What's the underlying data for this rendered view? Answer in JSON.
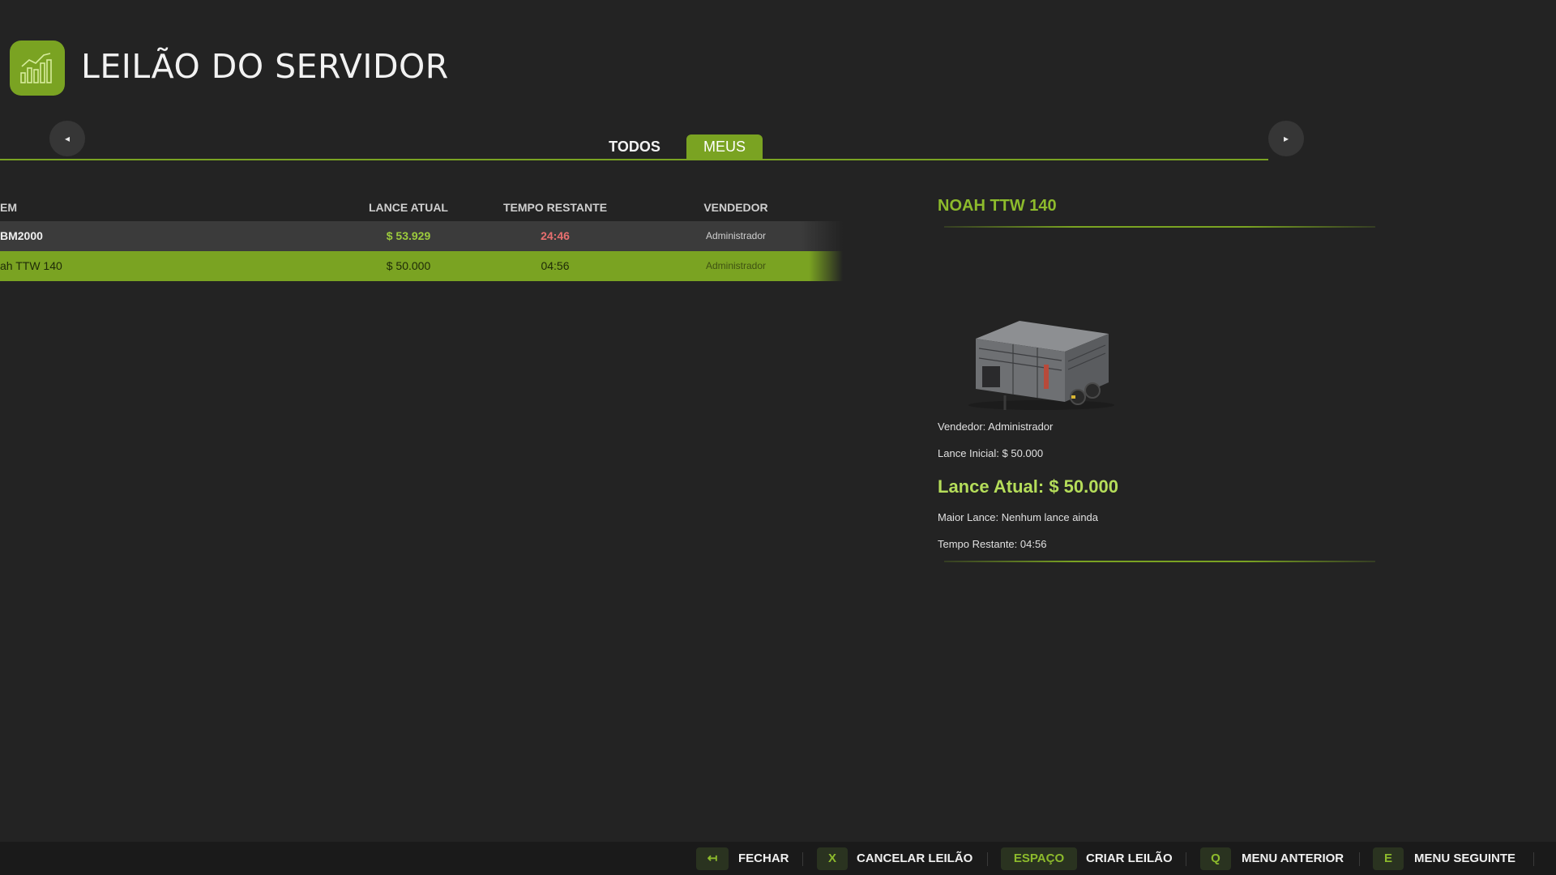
{
  "header": {
    "title": "LEILÃO DO SERVIDOR",
    "icon": "chart-bars-icon"
  },
  "tabs": [
    {
      "label": "TODOS",
      "active": false
    },
    {
      "label": "MEUS",
      "active": true
    }
  ],
  "nav": {
    "prev_icon": "◂",
    "next_icon": "▸"
  },
  "table": {
    "headers": {
      "item": "EM",
      "price": "LANCE ATUAL",
      "time": "TEMPO RESTANTE",
      "seller": "VENDEDOR"
    },
    "rows": [
      {
        "item": "BM2000",
        "price": "$ 53.929",
        "time": "24:46",
        "seller": "Administrador",
        "selected": false
      },
      {
        "item": "ah TTW 140",
        "price": "$ 50.000",
        "time": "04:56",
        "seller": "Administrador",
        "selected": true
      }
    ]
  },
  "detail": {
    "title": "NOAH TTW 140",
    "seller": "Vendedor: Administrador",
    "initial_bid": "Lance Inicial: $ 50.000",
    "current_bid": "Lance Atual: $ 50.000",
    "highest_bid": "Maior Lance: Nenhum lance ainda",
    "time_left": "Tempo Restante: 04:56"
  },
  "actions": [
    {
      "key": "↤",
      "label": "FECHAR"
    },
    {
      "key": "X",
      "label": "CANCELAR LEILÃO"
    },
    {
      "key": "ESPAÇO",
      "label": "CRIAR LEILÃO"
    },
    {
      "key": "Q",
      "label": "MENU ANTERIOR"
    },
    {
      "key": "E",
      "label": "MENU SEGUINTE"
    }
  ],
  "colors": {
    "accent": "#7aa322",
    "price_green": "#9ccb3c",
    "time_red": "#e86f6f",
    "background": "#232323"
  }
}
